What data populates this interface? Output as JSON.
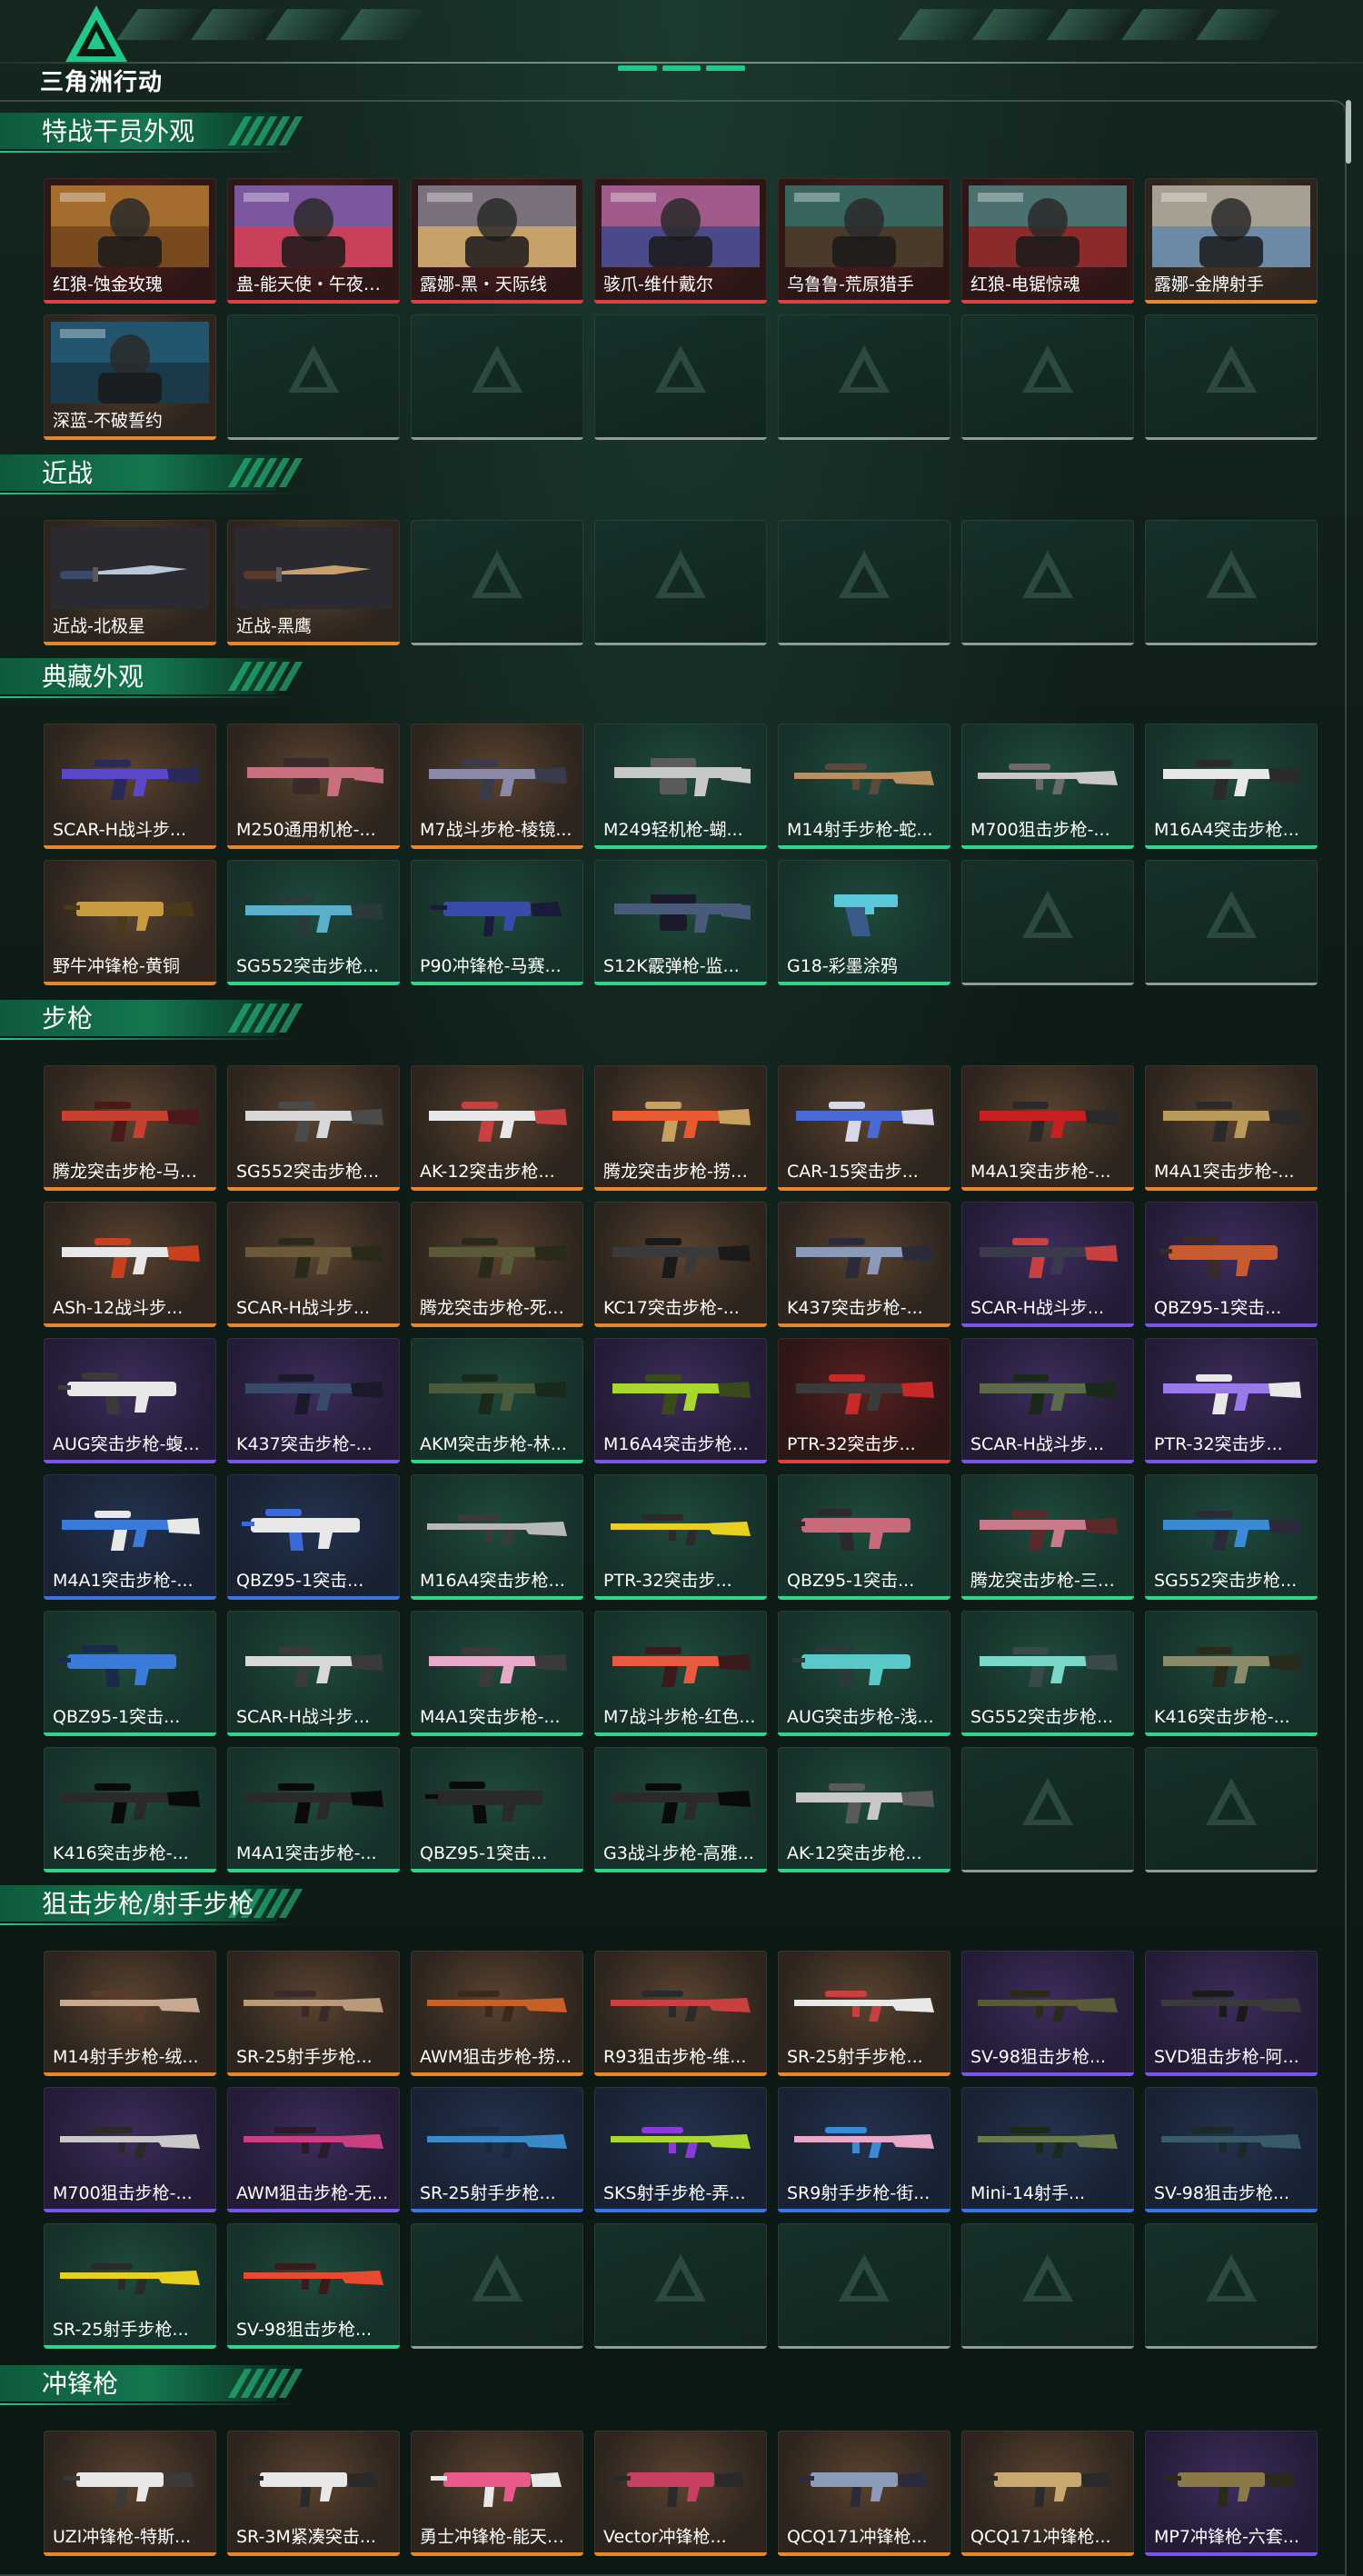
{
  "header": {
    "logo_text": "三角洲行动"
  },
  "colors": {
    "gold": "#e8862a",
    "green": "#2ed68a",
    "purple": "#7b54e8",
    "blue": "#3a74e6",
    "red": "#e04040",
    "accent": "#1ec98a"
  },
  "sections": [
    {
      "title": "特战干员外观",
      "cols": 7,
      "items": [
        {
          "name": "红狼-蚀金玫瑰",
          "rarity": "red",
          "kind": "operator",
          "c1": "#c78a3a",
          "c2": "#7a4a1f"
        },
        {
          "name": "蛊-能天使・午夜邮...",
          "rarity": "red",
          "kind": "operator",
          "c1": "#3a6ad8",
          "c2": "#c8405a"
        },
        {
          "name": "露娜-黑・天际线",
          "rarity": "red",
          "kind": "operator",
          "c1": "#3a4a8a",
          "c2": "#c8a06a"
        },
        {
          "name": "骇爪-维什戴尔",
          "rarity": "red",
          "kind": "operator",
          "c1": "#e86a8a",
          "c2": "#4a4a8a"
        },
        {
          "name": "乌鲁鲁-荒原猎手",
          "rarity": "red",
          "kind": "operator",
          "c1": "#2a8a8a",
          "c2": "#4a3a2a"
        },
        {
          "name": "红狼-电锯惊魂",
          "rarity": "red",
          "kind": "operator",
          "c1": "#1aa8a8",
          "c2": "#8a2a2a"
        },
        {
          "name": "露娜-金牌射手",
          "rarity": "gold",
          "kind": "operator",
          "c1": "#d8b080",
          "c2": "#6a8aa8"
        },
        {
          "name": "深蓝-不破誓约",
          "rarity": "gold",
          "kind": "operator",
          "c1": "#2a6a8a",
          "c2": "#1a3a4a"
        },
        {
          "empty": true
        },
        {
          "empty": true
        },
        {
          "empty": true
        },
        {
          "empty": true
        },
        {
          "empty": true
        },
        {
          "empty": true
        }
      ]
    },
    {
      "title": "近战",
      "cols": 7,
      "items": [
        {
          "name": "近战-北极星",
          "rarity": "gold",
          "kind": "knife",
          "c1": "#b8c8d8",
          "c2": "#3a4a6a"
        },
        {
          "name": "近战-黑鹰",
          "rarity": "gold",
          "kind": "knife",
          "c1": "#c8a070",
          "c2": "#5a3a2a"
        },
        {
          "empty": true
        },
        {
          "empty": true
        },
        {
          "empty": true
        },
        {
          "empty": true
        },
        {
          "empty": true
        }
      ]
    },
    {
      "title": "典藏外观",
      "cols": 7,
      "items": [
        {
          "name": "SCAR-H战斗步...",
          "rarity": "gold",
          "kind": "rifle",
          "c1": "#5a48c8",
          "c2": "#2a2a5a"
        },
        {
          "name": "M250通用机枪-...",
          "rarity": "gold",
          "kind": "lmg",
          "c1": "#c87080",
          "c2": "#3a2a2a"
        },
        {
          "name": "M7战斗步枪-棱镜...",
          "rarity": "gold",
          "kind": "rifle",
          "c1": "#8a8aa8",
          "c2": "#3a3a4a"
        },
        {
          "name": "M249轻机枪-蝴...",
          "rarity": "green",
          "kind": "lmg",
          "c1": "#c8c8c8",
          "c2": "#5a5a5a"
        },
        {
          "name": "M14射手步枪-蛇...",
          "rarity": "green",
          "kind": "dmr",
          "c1": "#b89060",
          "c2": "#5a4a3a"
        },
        {
          "name": "M700狙击步枪-...",
          "rarity": "green",
          "kind": "sniper",
          "c1": "#c8c8c8",
          "c2": "#6a6a6a"
        },
        {
          "name": "M16A4突击步枪...",
          "rarity": "green",
          "kind": "rifle",
          "c1": "#e8e8e8",
          "c2": "#2a2a2a"
        },
        {
          "name": "野牛冲锋枪-黄铜",
          "rarity": "gold",
          "kind": "smg",
          "c1": "#c89a40",
          "c2": "#4a3a1a"
        },
        {
          "name": "SG552突击步枪...",
          "rarity": "green",
          "kind": "rifle",
          "c1": "#5ab0c8",
          "c2": "#2a3a3a"
        },
        {
          "name": "P90冲锋枪-马赛...",
          "rarity": "green",
          "kind": "smg",
          "c1": "#3a4aa8",
          "c2": "#1a1a3a"
        },
        {
          "name": "S12K霰弹枪-监...",
          "rarity": "green",
          "kind": "shotgun",
          "c1": "#4a5a7a",
          "c2": "#1a1a2a"
        },
        {
          "name": "G18-彩墨涂鸦",
          "rarity": "green",
          "kind": "pistol",
          "c1": "#5ac8d8",
          "c2": "#3a5a8a"
        },
        {
          "empty": true
        },
        {
          "empty": true
        }
      ]
    },
    {
      "title": "步枪",
      "cols": 7,
      "items": [
        {
          "name": "腾龙突击步枪-马年...",
          "rarity": "gold",
          "kind": "rifle",
          "c1": "#c84030",
          "c2": "#4a1a1a"
        },
        {
          "name": "SG552突击步枪...",
          "rarity": "gold",
          "kind": "rifle",
          "c1": "#d8d8d8",
          "c2": "#4a4a4a"
        },
        {
          "name": "AK-12突击步枪...",
          "rarity": "gold",
          "kind": "rifle",
          "c1": "#e8e8e8",
          "c2": "#c84040"
        },
        {
          "name": "腾龙突击步枪-捞点...",
          "rarity": "gold",
          "kind": "rifle",
          "c1": "#e85a30",
          "c2": "#c8a060"
        },
        {
          "name": "CAR-15突击步...",
          "rarity": "gold",
          "kind": "rifle",
          "c1": "#4a6ad8",
          "c2": "#d8d8e8"
        },
        {
          "name": "M4A1突击步枪-...",
          "rarity": "gold",
          "kind": "rifle",
          "c1": "#c82020",
          "c2": "#2a2a2a"
        },
        {
          "name": "M4A1突击步枪-...",
          "rarity": "gold",
          "kind": "rifle",
          "c1": "#b89a5a",
          "c2": "#2a2a2a"
        },
        {
          "name": "ASh-12战斗步...",
          "rarity": "gold",
          "kind": "rifle",
          "c1": "#e8e8e8",
          "c2": "#c84020"
        },
        {
          "name": "SCAR-H战斗步...",
          "rarity": "gold",
          "kind": "rifle",
          "c1": "#6a5a3a",
          "c2": "#2a2a1a"
        },
        {
          "name": "腾龙突击步枪-死神...",
          "rarity": "gold",
          "kind": "rifle",
          "c1": "#5a5a3a",
          "c2": "#2a2a1a"
        },
        {
          "name": "KC17突击步枪-...",
          "rarity": "gold",
          "kind": "rifle",
          "c1": "#3a3a3a",
          "c2": "#1a1a1a"
        },
        {
          "name": "K437突击步枪-...",
          "rarity": "gold",
          "kind": "rifle",
          "c1": "#8a9ab8",
          "c2": "#2a2a3a"
        },
        {
          "name": "SCAR-H战斗步...",
          "rarity": "purple",
          "kind": "rifle",
          "c1": "#3a3a4a",
          "c2": "#c84040"
        },
        {
          "name": "QBZ95-1突击...",
          "rarity": "purple",
          "kind": "bullpup",
          "c1": "#c85a30",
          "c2": "#3a2a2a"
        },
        {
          "name": "AUG突击步枪-蝮...",
          "rarity": "purple",
          "kind": "bullpup",
          "c1": "#e8e8e8",
          "c2": "#3a3a3a"
        },
        {
          "name": "K437突击步枪-...",
          "rarity": "purple",
          "kind": "rifle",
          "c1": "#3a4a6a",
          "c2": "#1a1a2a"
        },
        {
          "name": "AKM突击步枪-林...",
          "rarity": "green",
          "kind": "rifle",
          "c1": "#4a5a3a",
          "c2": "#1a2a1a"
        },
        {
          "name": "M16A4突击步枪...",
          "rarity": "purple",
          "kind": "rifle",
          "c1": "#a8d830",
          "c2": "#3a4a1a"
        },
        {
          "name": "PTR-32突击步...",
          "rarity": "red",
          "kind": "rifle",
          "c1": "#3a3a3a",
          "c2": "#c82a2a"
        },
        {
          "name": "SCAR-H战斗步...",
          "rarity": "purple",
          "kind": "rifle",
          "c1": "#5a6a4a",
          "c2": "#1a2a1a"
        },
        {
          "name": "PTR-32突击步...",
          "rarity": "purple",
          "kind": "rifle",
          "c1": "#9a7ae8",
          "c2": "#e8e8e8"
        },
        {
          "name": "M4A1突击步枪-...",
          "rarity": "blue",
          "kind": "rifle",
          "c1": "#3a7ad8",
          "c2": "#e8e8e8"
        },
        {
          "name": "QBZ95-1突击...",
          "rarity": "blue",
          "kind": "bullpup",
          "c1": "#e8e8e8",
          "c2": "#3a6ad8"
        },
        {
          "name": "M16A4突击步枪...",
          "rarity": "green",
          "kind": "sniper",
          "c1": "#b8b8b8",
          "c2": "#3a3a3a"
        },
        {
          "name": "PTR-32突击步...",
          "rarity": "green",
          "kind": "sniper",
          "c1": "#e8d020",
          "c2": "#2a2a2a"
        },
        {
          "name": "QBZ95-1突击...",
          "rarity": "green",
          "kind": "bullpup",
          "c1": "#c86a7a",
          "c2": "#2a2a2a"
        },
        {
          "name": "腾龙突击步枪-三角...",
          "rarity": "green",
          "kind": "rifle",
          "c1": "#c87a8a",
          "c2": "#5a2a2a"
        },
        {
          "name": "SG552突击步枪...",
          "rarity": "green",
          "kind": "rifle",
          "c1": "#3a8ad8",
          "c2": "#2a2a3a"
        },
        {
          "name": "QBZ95-1突击...",
          "rarity": "green",
          "kind": "bullpup",
          "c1": "#3a7ad8",
          "c2": "#1a2a4a"
        },
        {
          "name": "SCAR-H战斗步...",
          "rarity": "green",
          "kind": "rifle",
          "c1": "#d8d8d8",
          "c2": "#3a3a3a"
        },
        {
          "name": "M4A1突击步枪-...",
          "rarity": "green",
          "kind": "rifle",
          "c1": "#e8a8c8",
          "c2": "#3a3a3a"
        },
        {
          "name": "M7战斗步枪-红色...",
          "rarity": "green",
          "kind": "rifle",
          "c1": "#e85a40",
          "c2": "#3a1a1a"
        },
        {
          "name": "AUG突击步枪-浅...",
          "rarity": "green",
          "kind": "bullpup",
          "c1": "#5ac8c8",
          "c2": "#2a3a3a"
        },
        {
          "name": "SG552突击步枪...",
          "rarity": "green",
          "kind": "rifle",
          "c1": "#7ad8c8",
          "c2": "#3a4a4a"
        },
        {
          "name": "K416突击步枪-...",
          "rarity": "green",
          "kind": "rifle",
          "c1": "#8a8a6a",
          "c2": "#2a2a1a"
        },
        {
          "name": "K416突击步枪-...",
          "rarity": "green",
          "kind": "rifle",
          "c1": "#2a2a2a",
          "c2": "#0a0a0a"
        },
        {
          "name": "M4A1突击步枪-...",
          "rarity": "green",
          "kind": "rifle",
          "c1": "#2a2a2a",
          "c2": "#0a0a0a"
        },
        {
          "name": "QBZ95-1突击...",
          "rarity": "green",
          "kind": "bullpup",
          "c1": "#2a2a2a",
          "c2": "#0a0a0a"
        },
        {
          "name": "G3战斗步枪-高雅...",
          "rarity": "green",
          "kind": "rifle",
          "c1": "#2a2a2a",
          "c2": "#0a0a0a"
        },
        {
          "name": "AK-12突击步枪...",
          "rarity": "green",
          "kind": "rifle",
          "c1": "#c8c8c8",
          "c2": "#5a5a5a"
        },
        {
          "empty": true
        },
        {
          "empty": true
        }
      ]
    },
    {
      "title": "狙击步枪/射手步枪",
      "cols": 7,
      "items": [
        {
          "name": "M14射手步枪-绒...",
          "rarity": "gold",
          "kind": "dmr",
          "c1": "#c8a890",
          "c2": "#5a3a2a"
        },
        {
          "name": "SR-25射手步枪...",
          "rarity": "gold",
          "kind": "dmr",
          "c1": "#b89a7a",
          "c2": "#3a2a2a"
        },
        {
          "name": "AWM狙击步枪-捞...",
          "rarity": "gold",
          "kind": "sniper",
          "c1": "#c8602a",
          "c2": "#3a2a1a"
        },
        {
          "name": "R93狙击步枪-维...",
          "rarity": "gold",
          "kind": "sniper",
          "c1": "#c84040",
          "c2": "#2a2a2a"
        },
        {
          "name": "SR-25射手步枪...",
          "rarity": "gold",
          "kind": "dmr",
          "c1": "#e8e8e8",
          "c2": "#c84040"
        },
        {
          "name": "SV-98狙击步枪...",
          "rarity": "purple",
          "kind": "sniper",
          "c1": "#5a5a3a",
          "c2": "#2a2a1a"
        },
        {
          "name": "SVD狙击步枪-阿...",
          "rarity": "purple",
          "kind": "sniper",
          "c1": "#3a3a3a",
          "c2": "#1a1a1a"
        },
        {
          "name": "M700狙击步枪-...",
          "rarity": "purple",
          "kind": "sniper",
          "c1": "#c8c8c8",
          "c2": "#2a2a2a"
        },
        {
          "name": "AWM狙击步枪-无...",
          "rarity": "purple",
          "kind": "sniper",
          "c1": "#c84080",
          "c2": "#2a1a2a"
        },
        {
          "name": "SR-25射手步枪...",
          "rarity": "blue",
          "kind": "dmr",
          "c1": "#3a8ac8",
          "c2": "#1a2a3a"
        },
        {
          "name": "SKS射手步枪-弄...",
          "rarity": "blue",
          "kind": "dmr",
          "c1": "#a8d830",
          "c2": "#8a3ad8"
        },
        {
          "name": "SR9射手步枪-街...",
          "rarity": "blue",
          "kind": "sniper",
          "c1": "#e8a8c8",
          "c2": "#3a8ad8"
        },
        {
          "name": "Mini-14射手...",
          "rarity": "blue",
          "kind": "dmr",
          "c1": "#6a7a4a",
          "c2": "#1a2a1a"
        },
        {
          "name": "SV-98狙击步枪...",
          "rarity": "blue",
          "kind": "sniper",
          "c1": "#3a5a6a",
          "c2": "#1a2a2a"
        },
        {
          "name": "SR-25射手步枪...",
          "rarity": "green",
          "kind": "sniper",
          "c1": "#e8d020",
          "c2": "#2a2a2a"
        },
        {
          "name": "SV-98狙击步枪...",
          "rarity": "green",
          "kind": "sniper",
          "c1": "#e84a30",
          "c2": "#3a1a1a"
        },
        {
          "empty": true
        },
        {
          "empty": true
        },
        {
          "empty": true
        },
        {
          "empty": true
        },
        {
          "empty": true
        }
      ]
    },
    {
      "title": "冲锋枪",
      "cols": 7,
      "items": [
        {
          "name": "UZI冲锋枪-特斯...",
          "rarity": "gold",
          "kind": "smg",
          "c1": "#e8e8e8",
          "c2": "#3a3a3a"
        },
        {
          "name": "SR-3M紧凑突击...",
          "rarity": "gold",
          "kind": "smg",
          "c1": "#e8e8e8",
          "c2": "#2a2a2a"
        },
        {
          "name": "勇士冲锋枪-能天使...",
          "rarity": "gold",
          "kind": "smg",
          "c1": "#e85a8a",
          "c2": "#e8e8e8"
        },
        {
          "name": "Vector冲锋枪...",
          "rarity": "gold",
          "kind": "smg",
          "c1": "#c84060",
          "c2": "#2a2a2a"
        },
        {
          "name": "QCQ171冲锋枪...",
          "rarity": "gold",
          "kind": "smg",
          "c1": "#8a9ab8",
          "c2": "#2a2a3a"
        },
        {
          "name": "QCQ171冲锋枪...",
          "rarity": "gold",
          "kind": "smg",
          "c1": "#c8a870",
          "c2": "#2a2a2a"
        },
        {
          "name": "MP7冲锋枪-六套...",
          "rarity": "purple",
          "kind": "smg",
          "c1": "#8a7a4a",
          "c2": "#2a2a1a"
        }
      ]
    }
  ]
}
